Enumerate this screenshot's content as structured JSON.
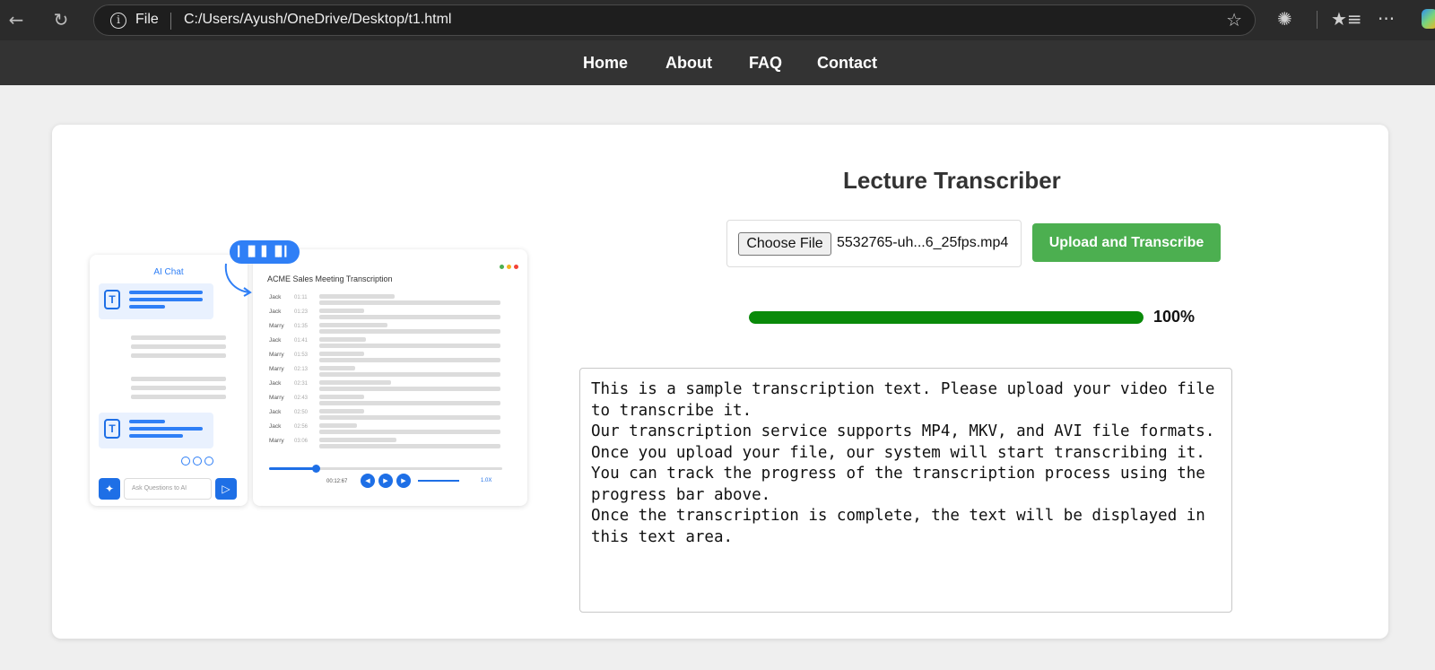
{
  "browser": {
    "back_icon": "back-arrow-icon",
    "reload_icon": "reload-icon",
    "protocol_label": "File",
    "url": "C:/Users/Ayush/OneDrive/Desktop/t1.html",
    "favorite_icon": "star-icon",
    "extensions_icon": "puzzle-icon",
    "favorites_icon": "favorites-list-icon",
    "more_icon": "more-ellipsis-icon",
    "more_glyph": "···"
  },
  "nav": {
    "links": [
      "Home",
      "About",
      "FAQ",
      "Contact"
    ]
  },
  "illustration": {
    "chat_title": "AI Chat",
    "chat_input_placeholder": "Ask Questions to AI",
    "transcription_title": "ACME Sales Meeting Transcription",
    "speakers": [
      {
        "name": "Jack",
        "time": "01:11"
      },
      {
        "name": "Jack",
        "time": "01:23"
      },
      {
        "name": "Marry",
        "time": "01:35"
      },
      {
        "name": "Jack",
        "time": "01:41"
      },
      {
        "name": "Marry",
        "time": "01:53"
      },
      {
        "name": "Marry",
        "time": "02:13"
      },
      {
        "name": "Jack",
        "time": "02:31"
      },
      {
        "name": "Marry",
        "time": "02:43"
      },
      {
        "name": "Jack",
        "time": "02:50"
      },
      {
        "name": "Jack",
        "time": "02:56"
      },
      {
        "name": "Marry",
        "time": "03:06"
      }
    ],
    "player_time": "00:12:67",
    "speed": "1.0X",
    "dot_colors": [
      "#4caf50",
      "#f5b21f",
      "#f44336"
    ],
    "accent_color": "#2f7ff6"
  },
  "form": {
    "title": "Lecture Transcriber",
    "choose_file_label": "Choose File",
    "file_name": "5532765-uh...6_25fps.mp4",
    "upload_label": "Upload and Transcribe",
    "upload_color": "#4caf50",
    "progress_value": 1.0,
    "progress_label": "100%",
    "progress_color": "#0a8a0a",
    "transcript": "This is a sample transcription text. Please upload your video file to transcribe it.\nOur transcription service supports MP4, MKV, and AVI file formats.\nOnce you upload your file, our system will start transcribing it.\nYou can track the progress of the transcription process using the progress bar above.\nOnce the transcription is complete, the text will be displayed in this text area."
  }
}
